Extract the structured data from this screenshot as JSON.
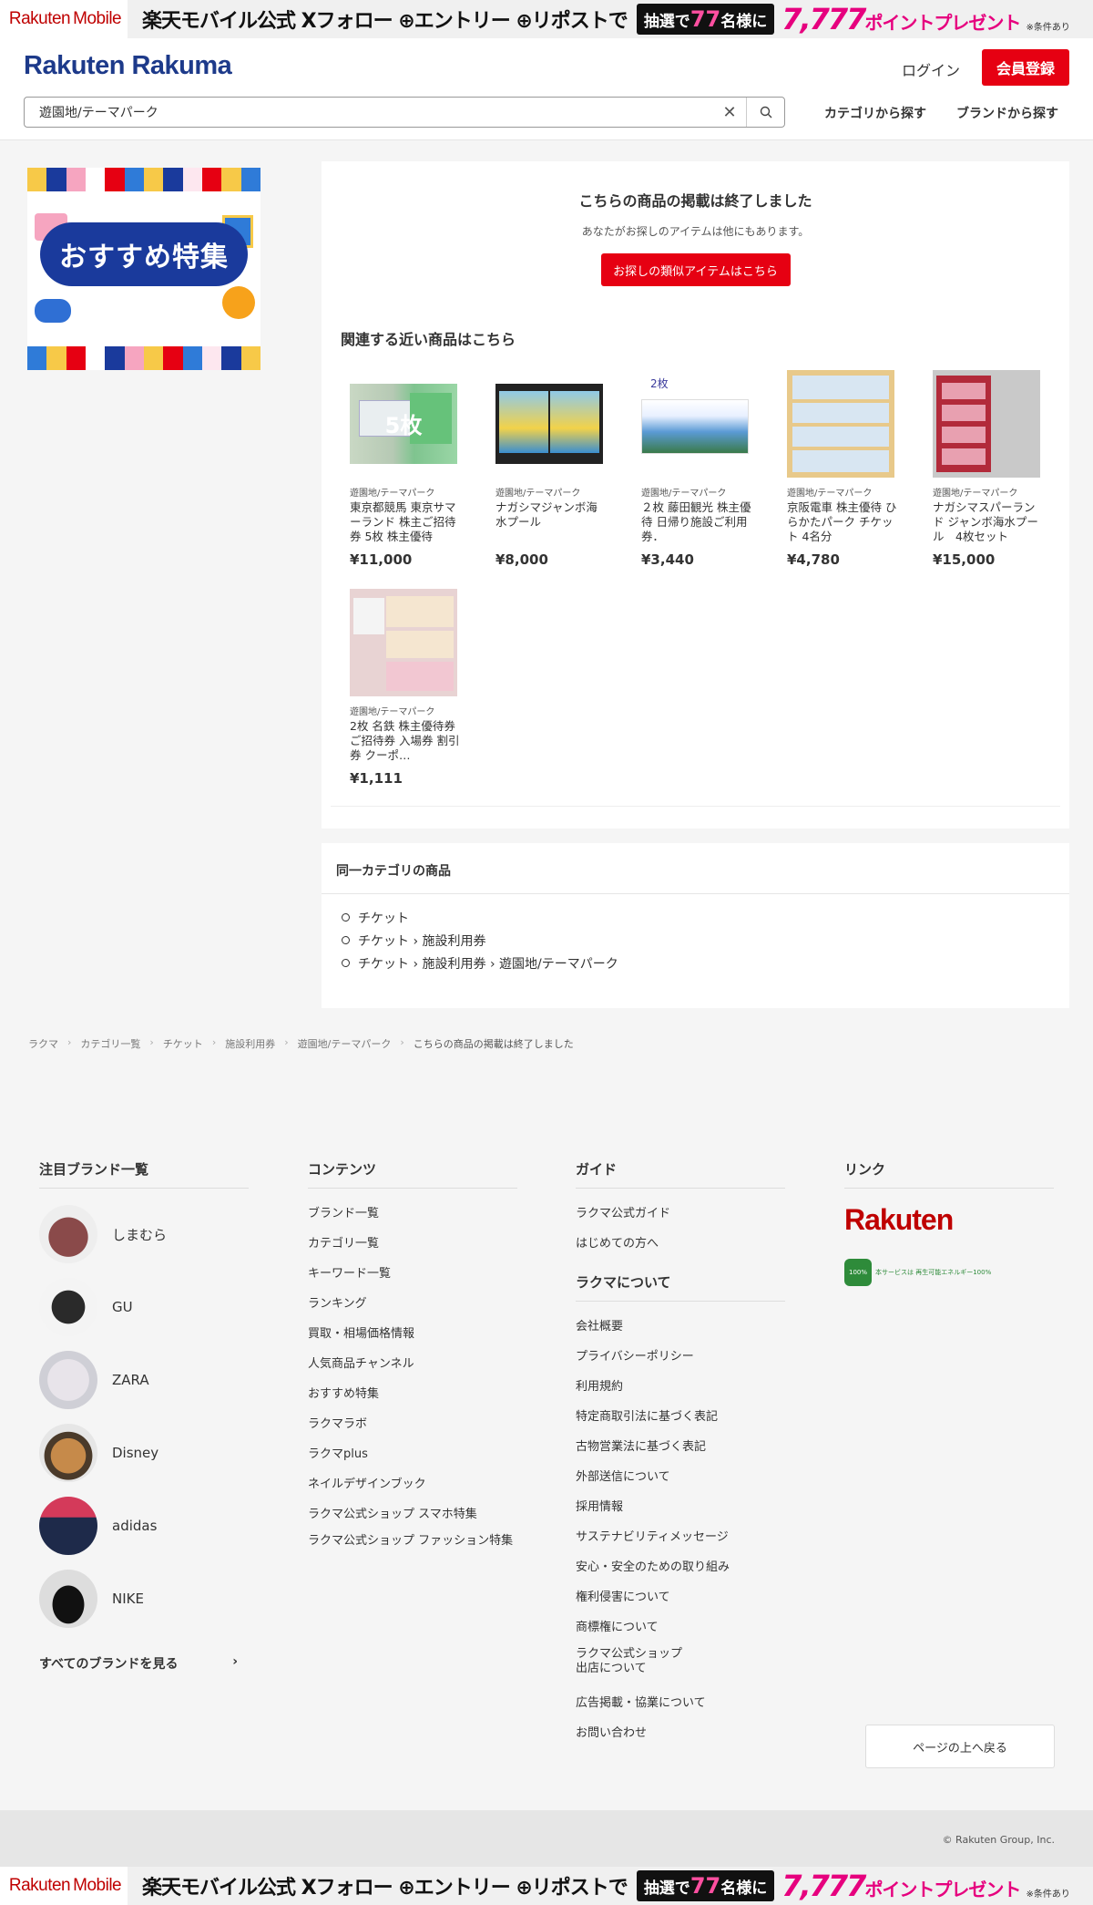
{
  "promo": {
    "brand_main": "Rakuten",
    "brand_sub": "Mobile",
    "text": "楽天モバイル公式 Xフォロー ⊕エントリー ⊕リポストで",
    "lottery_pre": "抽選で",
    "lottery_num": "77",
    "lottery_post": "名様に",
    "points": "7,777",
    "points_suffix": "ポイントプレゼント",
    "condition": "※条件あり"
  },
  "header": {
    "logo": "Rakuten Rakuma",
    "login": "ログイン",
    "signup": "会員登録",
    "search_value": "遊園地/テーマパーク",
    "nav_category": "カテゴリから探す",
    "nav_brand": "ブランドから探す"
  },
  "feature_banner": {
    "text": "おすすめ特集"
  },
  "notice": {
    "title": "こちらの商品の掲載は終了しました",
    "sub": "あなたがお探しのアイテムは他にもあります。",
    "button": "お探しの類似アイテムはこちら"
  },
  "related": {
    "title": "関連する近い商品はこちら",
    "items": [
      {
        "cat": "遊園地/テーマパーク",
        "name": "東京都競馬 東京サマーランド 株主ご招待券 5枚 株主優待",
        "price": "¥11,000",
        "overlay": "5枚"
      },
      {
        "cat": "遊園地/テーマパーク",
        "name": "ナガシマジャンボ海水プール",
        "price": "¥8,000",
        "overlay": ""
      },
      {
        "cat": "遊園地/テーマパーク",
        "name": "２枚 藤田観光 株主優待 日帰り施設ご利用券．",
        "price": "¥3,440",
        "overlay": "2枚"
      },
      {
        "cat": "遊園地/テーマパーク",
        "name": "京阪電車 株主優待 ひらかたパーク チケット 4名分",
        "price": "¥4,780",
        "overlay": ""
      },
      {
        "cat": "遊園地/テーマパーク",
        "name": "ナガシマスパーランド ジャンボ海水プール　4枚セット",
        "price": "¥15,000",
        "overlay": ""
      },
      {
        "cat": "遊園地/テーマパーク",
        "name": "2枚 名鉄 株主優待券 ご招待券 入場券 割引券 クーポ…",
        "price": "¥1,111",
        "overlay": ""
      }
    ]
  },
  "same_category": {
    "title": "同一カテゴリの商品",
    "items": [
      "チケット",
      "チケット › 施設利用券",
      "チケット › 施設利用券 › 遊園地/テーマパーク"
    ]
  },
  "breadcrumb": [
    "ラクマ",
    "カテゴリ一覧",
    "チケット",
    "施設利用券",
    "遊園地/テーマパーク",
    "こちらの商品の掲載は終了しました"
  ],
  "footer": {
    "brands_title": "注目ブランド一覧",
    "brands": [
      "しまむら",
      "GU",
      "ZARA",
      "Disney",
      "adidas",
      "NIKE"
    ],
    "all_brands": "すべてのブランドを見る",
    "contents_title": "コンテンツ",
    "contents": [
      "ブランド一覧",
      "カテゴリ一覧",
      "キーワード一覧",
      "ランキング",
      "買取・相場価格情報",
      "人気商品チャンネル",
      "おすすめ特集",
      "ラクマラボ",
      "ラクマplus",
      "ネイルデザインブック",
      "ラクマ公式ショップ スマホ特集",
      "ラクマ公式ショップ ファッション特集"
    ],
    "guide_title": "ガイド",
    "guide": [
      "ラクマ公式ガイド",
      "はじめての方へ"
    ],
    "about_title": "ラクマについて",
    "about": [
      "会社概要",
      "プライバシーポリシー",
      "利用規約",
      "特定商取引法に基づく表記",
      "古物営業法に基づく表記",
      "外部送信について",
      "採用情報",
      "サステナビリティメッセージ",
      "安心・安全のための取り組み",
      "権利侵害について",
      "商標権について",
      "ラクマ公式ショップ 出店について",
      "広告掲載・協業について",
      "お問い合わせ"
    ],
    "link_title": "リンク",
    "rakuten_logo": "Rakuten",
    "green_badge_icon": "100%",
    "green_badge_text": "本サービスは 再生可能エネルギー100%",
    "to_top": "ページの上へ戻る",
    "copyright": "© Rakuten Group, Inc."
  }
}
